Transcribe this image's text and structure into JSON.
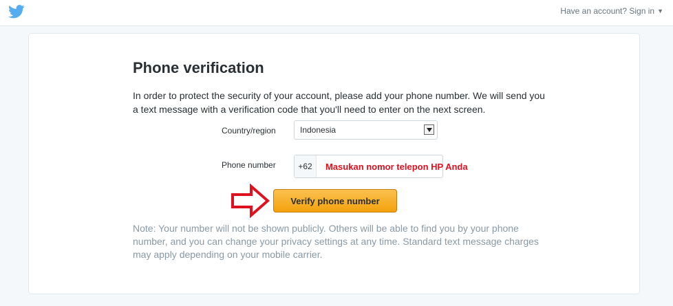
{
  "header": {
    "logo_icon": "twitter-bird-icon",
    "signin_text": "Have an account? Sign in",
    "caret_icon": "caret-down-icon"
  },
  "form": {
    "title": "Phone verification",
    "intro": "In order to protect the security of your account, please add your phone number. We will send you a text message with a verification code that you'll need to enter on the next screen.",
    "country_label": "Country/region",
    "country_value": "Indonesia",
    "phone_label": "Phone number",
    "phone_prefix": "+62",
    "phone_value": "",
    "verify_label": "Verify phone number",
    "note": "Note: Your number will not be shown publicly. Others will be able to find you by your phone number, and you can change your privacy settings at any time. Standard text message charges may apply depending on your mobile carrier."
  },
  "annotation": {
    "overlay_text": "Masukan nomor telepon HP Anda",
    "arrow_icon": "red-outline-arrow-right-icon"
  },
  "colors": {
    "brand": "#55acee",
    "button": "#f4a20d",
    "annotation": "#e0111e"
  }
}
